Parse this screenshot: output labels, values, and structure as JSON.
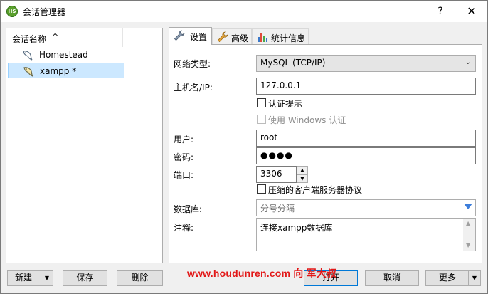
{
  "window": {
    "title": "会话管理器",
    "app_icon": "HS",
    "help_label": "?",
    "close_label": "✕"
  },
  "session_list": {
    "column_header": "会话名称",
    "sort_indicator": "^",
    "items": [
      {
        "label": "Homestead",
        "icon": "dolphin-icon",
        "selected": false
      },
      {
        "label": "xampp *",
        "icon": "dolphin-icon",
        "selected": true
      }
    ]
  },
  "tabs": [
    {
      "label": "设置",
      "icon": "wrench-icon",
      "active": true
    },
    {
      "label": "高级",
      "icon": "wrench-orange-icon",
      "active": false
    },
    {
      "label": "统计信息",
      "icon": "bar-chart-icon",
      "active": false
    }
  ],
  "settings": {
    "network_type_label": "网络类型:",
    "network_type_value": "MySQL (TCP/IP)",
    "host_label": "主机名/IP:",
    "host_value": "127.0.0.1",
    "auth_prompt_label": "认证提示",
    "auth_prompt_checked": false,
    "windows_auth_label": "使用 Windows 认证",
    "windows_auth_checked": false,
    "user_label": "用户:",
    "user_value": "root",
    "password_label": "密码:",
    "password_value": "●●●●",
    "port_label": "端口:",
    "port_value": "3306",
    "compress_label": "压缩的客户端服务器协议",
    "compress_checked": false,
    "database_label": "数据库:",
    "database_placeholder": "分号分隔",
    "comment_label": "注释:",
    "comment_value": "连接xampp数据库"
  },
  "buttons": {
    "new": "新建",
    "save": "保存",
    "delete": "删除",
    "open": "打开",
    "cancel": "取消",
    "more": "更多"
  },
  "watermark": "www.houdunren.com 向 军大叔"
}
